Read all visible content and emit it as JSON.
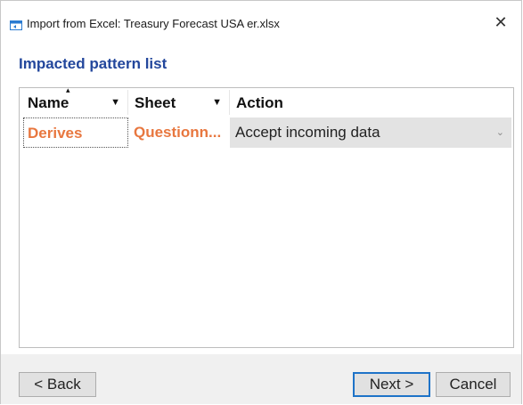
{
  "window": {
    "title": "Import from Excel: Treasury Forecast USA er.xlsx",
    "close_symbol": "✕"
  },
  "section": {
    "title": "Impacted pattern list"
  },
  "grid": {
    "columns": [
      {
        "label": "Name",
        "sort_indicator": "▴",
        "filter_icon": "▼"
      },
      {
        "label": "Sheet",
        "filter_icon": "▼"
      },
      {
        "label": "Action"
      }
    ],
    "rows": [
      {
        "name": "Derives",
        "sheet": "Questionn...",
        "action": "Accept incoming data",
        "dropdown_icon": "⌄"
      }
    ]
  },
  "footer": {
    "back_label": "< Back",
    "next_label": "Next >",
    "cancel_label": "Cancel"
  },
  "colors": {
    "title_accent": "#23479c",
    "row_highlight": "#e8773f",
    "action_bg": "#e3e3e3",
    "default_button_border": "#1e73c8"
  }
}
